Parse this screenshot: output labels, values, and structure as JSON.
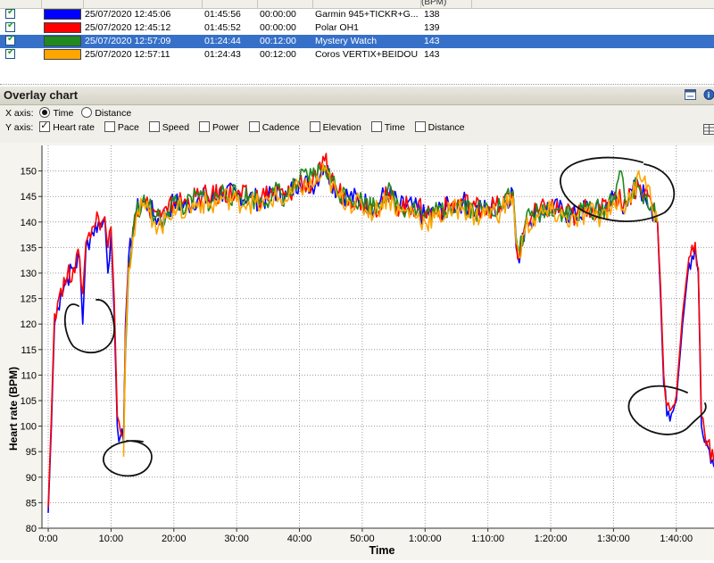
{
  "table": {
    "header_partial": "(BPM)",
    "rows": [
      {
        "checked": true,
        "color": "#0000ff",
        "start": "25/07/2020 12:45:06",
        "duration": "01:45:56",
        "offset": "00:00:00",
        "device": "Garmin  945+TICKR+G...",
        "avg_hr": "138",
        "selected": false
      },
      {
        "checked": true,
        "color": "#ff0000",
        "start": "25/07/2020 12:45:12",
        "duration": "01:45:52",
        "offset": "00:00:00",
        "device": "Polar OH1",
        "avg_hr": "139",
        "selected": false
      },
      {
        "checked": true,
        "color": "#1f8a1f",
        "start": "25/07/2020 12:57:09",
        "duration": "01:24:44",
        "offset": "00:12:00",
        "device": "Mystery Watch",
        "avg_hr": "143",
        "selected": true
      },
      {
        "checked": true,
        "color": "#ffa500",
        "start": "25/07/2020 12:57:11",
        "duration": "01:24:43",
        "offset": "00:12:00",
        "device": "Coros VERTIX+BEIDOU",
        "avg_hr": "143",
        "selected": false
      }
    ]
  },
  "panel": {
    "title": "Overlay chart",
    "xaxis_label": "X axis:",
    "xaxis_options": [
      {
        "label": "Time",
        "selected": true
      },
      {
        "label": "Distance",
        "selected": false
      }
    ],
    "yaxis_label": "Y axis:",
    "yaxis_options": [
      {
        "label": "Heart rate",
        "checked": true
      },
      {
        "label": "Pace",
        "checked": false
      },
      {
        "label": "Speed",
        "checked": false
      },
      {
        "label": "Power",
        "checked": false
      },
      {
        "label": "Cadence",
        "checked": false
      },
      {
        "label": "Elevation",
        "checked": false
      },
      {
        "label": "Time",
        "checked": false
      },
      {
        "label": "Distance",
        "checked": false
      }
    ],
    "icons": [
      "minimize-icon",
      "info-icon",
      "grid-icon"
    ]
  },
  "chart_data": {
    "type": "line",
    "xlabel": "Time",
    "ylabel": "Heart rate (BPM)",
    "ylim": [
      80,
      155
    ],
    "xlim_minutes": [
      -1,
      106
    ],
    "yticks": [
      80,
      85,
      90,
      95,
      100,
      105,
      110,
      115,
      120,
      125,
      130,
      135,
      140,
      145,
      150
    ],
    "xticks": [
      {
        "min": 0,
        "label": "0:00"
      },
      {
        "min": 10,
        "label": "10:00"
      },
      {
        "min": 20,
        "label": "20:00"
      },
      {
        "min": 30,
        "label": "30:00"
      },
      {
        "min": 40,
        "label": "40:00"
      },
      {
        "min": 50,
        "label": "50:00"
      },
      {
        "min": 60,
        "label": "1:00:00"
      },
      {
        "min": 70,
        "label": "1:10:00"
      },
      {
        "min": 80,
        "label": "1:20:00"
      },
      {
        "min": 90,
        "label": "1:30:00"
      },
      {
        "min": 100,
        "label": "1:40:00"
      }
    ],
    "grid": true,
    "series": [
      {
        "name": "Garmin  945+TICKR+G...",
        "color": "#0000ff",
        "x": [
          0,
          0.5,
          1,
          2,
          3,
          4,
          5,
          5.5,
          6,
          7,
          8,
          8.5,
          9,
          9.5,
          10,
          10.5,
          11,
          11.5,
          12,
          12.3,
          12.8,
          13.5,
          14,
          15,
          16,
          17,
          18,
          19,
          20,
          22,
          24,
          26,
          28,
          30,
          32,
          34,
          36,
          38,
          40,
          42,
          43.5,
          44,
          46,
          48,
          50,
          52,
          54,
          56,
          58,
          60,
          62,
          64,
          66,
          68,
          70,
          72,
          74,
          74.5,
          75,
          76,
          78,
          80,
          82,
          84,
          86,
          88,
          90,
          92,
          93,
          94,
          95,
          96,
          97,
          97.5,
          98,
          98.5,
          99,
          99.5,
          100,
          101,
          102,
          103,
          103.5,
          104,
          105,
          106
        ],
        "y": [
          83,
          100,
          120,
          126,
          129,
          131,
          133,
          120,
          135,
          138,
          140,
          139,
          141,
          130,
          138,
          122,
          100,
          98,
          97,
          120,
          133,
          138,
          142,
          144,
          143,
          141,
          140,
          142,
          144,
          143,
          145,
          144,
          146,
          145,
          145,
          144,
          146,
          145,
          148,
          147,
          150,
          151,
          146,
          145,
          144,
          143,
          146,
          143,
          143,
          141,
          142,
          143,
          144,
          142,
          143,
          143,
          146,
          135,
          132,
          140,
          142,
          143,
          142,
          141,
          143,
          142,
          145,
          143,
          146,
          147,
          145,
          143,
          140,
          125,
          108,
          102,
          101,
          103,
          105,
          120,
          132,
          135,
          130,
          100,
          96,
          92
        ]
      },
      {
        "name": "Polar OH1",
        "color": "#ff0000",
        "x": [
          0,
          0.5,
          1,
          2,
          3,
          4,
          5,
          5.5,
          6,
          7,
          8,
          8.5,
          9,
          9.5,
          10,
          10.5,
          11,
          11.5,
          12,
          12.3,
          12.8,
          13.5,
          14,
          15,
          16,
          17,
          18,
          19,
          20,
          22,
          24,
          26,
          28,
          30,
          32,
          34,
          36,
          38,
          40,
          42,
          43.5,
          44,
          46,
          48,
          50,
          52,
          54,
          56,
          58,
          60,
          62,
          64,
          66,
          68,
          70,
          72,
          74,
          74.5,
          75,
          76,
          78,
          80,
          82,
          84,
          86,
          88,
          90,
          92,
          93,
          94,
          95,
          96,
          97,
          97.5,
          98,
          98.5,
          99,
          99.5,
          100,
          101,
          102,
          103,
          103.5,
          104,
          105,
          106
        ],
        "y": [
          84,
          102,
          122,
          127,
          129,
          131,
          133,
          126,
          136,
          139,
          141,
          140,
          141,
          135,
          139,
          125,
          102,
          99,
          98,
          118,
          132,
          139,
          142,
          144,
          143,
          142,
          141,
          142,
          144,
          144,
          145,
          145,
          146,
          145,
          145,
          145,
          146,
          145,
          148,
          147,
          150,
          152,
          146,
          145,
          144,
          143,
          145,
          143,
          143,
          142,
          142,
          143,
          144,
          143,
          143,
          143,
          146,
          136,
          133,
          140,
          142,
          143,
          142,
          141,
          143,
          142,
          145,
          144,
          146,
          147,
          146,
          144,
          140,
          127,
          110,
          104,
          103,
          104,
          106,
          122,
          133,
          136,
          131,
          102,
          97,
          93
        ]
      },
      {
        "name": "Mystery Watch",
        "color": "#1f8a1f",
        "x": [
          12,
          12.3,
          12.8,
          13.5,
          14,
          15,
          16,
          17,
          18,
          19,
          20,
          22,
          24,
          26,
          28,
          30,
          32,
          34,
          36,
          38,
          40,
          42,
          43.5,
          44,
          46,
          48,
          50,
          52,
          54,
          56,
          58,
          60,
          62,
          64,
          66,
          68,
          70,
          72,
          74,
          74.5,
          75,
          76,
          78,
          80,
          82,
          84,
          86,
          88,
          90,
          91,
          92,
          93,
          94,
          95,
          96,
          97
        ],
        "y": [
          97,
          114,
          130,
          138,
          142,
          144,
          143,
          141,
          140,
          142,
          144,
          143,
          145,
          144,
          146,
          145,
          145,
          144,
          146,
          145,
          148,
          149,
          150,
          151,
          146,
          145,
          144,
          143,
          146,
          143,
          143,
          141,
          142,
          143,
          144,
          142,
          143,
          143,
          146,
          137,
          134,
          140,
          142,
          143,
          142,
          141,
          143,
          142,
          145,
          150,
          143,
          146,
          147,
          145,
          143,
          140
        ]
      },
      {
        "name": "Coros VERTIX+BEIDOU",
        "color": "#ffa500",
        "x": [
          12,
          12.3,
          12.8,
          13.5,
          14,
          15,
          16,
          17,
          18,
          19,
          20,
          22,
          24,
          26,
          28,
          30,
          32,
          34,
          36,
          38,
          40,
          42,
          43.5,
          44,
          46,
          48,
          50,
          52,
          54,
          56,
          58,
          60,
          62,
          64,
          66,
          68,
          70,
          72,
          74,
          74.5,
          75,
          76,
          78,
          80,
          82,
          84,
          86,
          88,
          90,
          92,
          93,
          94,
          95,
          96,
          97
        ],
        "y": [
          94,
          116,
          131,
          137,
          141,
          143,
          142,
          140,
          139,
          141,
          143,
          142,
          144,
          143,
          145,
          144,
          144,
          143,
          145,
          144,
          147,
          147,
          149,
          150,
          145,
          144,
          143,
          142,
          145,
          142,
          142,
          140,
          141,
          142,
          143,
          141,
          142,
          142,
          145,
          136,
          133,
          139,
          141,
          142,
          141,
          140,
          142,
          141,
          144,
          143,
          145,
          150,
          149,
          144,
          140
        ]
      }
    ],
    "annotations": [
      "hand-drawn circle",
      "hand-drawn circle",
      "hand-drawn circle",
      "hand-drawn circle"
    ]
  }
}
